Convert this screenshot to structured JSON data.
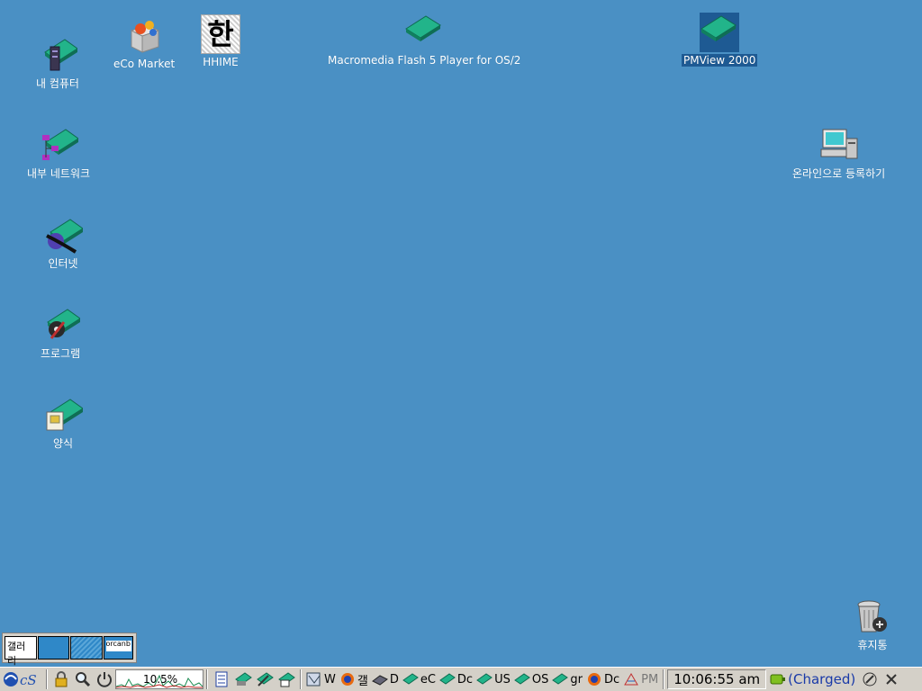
{
  "desktop": {
    "icons": {
      "my_computer": "내 컴퓨터",
      "eco_market": "eCo Market",
      "hhime": "HHIME",
      "flash": "Macromedia Flash 5 Player for OS/2",
      "pmview": "PMView 2000",
      "network": "내부 네트워크",
      "register": "온라인으로 등록하기",
      "internet": "인터넷",
      "programs": "프로그램",
      "templates": "양식",
      "trash": "휴지통"
    },
    "hhime_glyph": "한",
    "background_color": "#4a90c4"
  },
  "pager": {
    "desk1_label": "갤러리",
    "desk4_label": "orcanb"
  },
  "taskbar": {
    "cpu_value": "10.5%",
    "tasks": {
      "t1": "W",
      "t2": "갤",
      "t3": "D",
      "t4": "eC",
      "t5": "Dc",
      "t6": "US",
      "t7": "OS",
      "t8": "gr",
      "t9": "Dc",
      "t10": "PM"
    },
    "clock": "10:06:55 am",
    "battery": "(Charged)"
  }
}
